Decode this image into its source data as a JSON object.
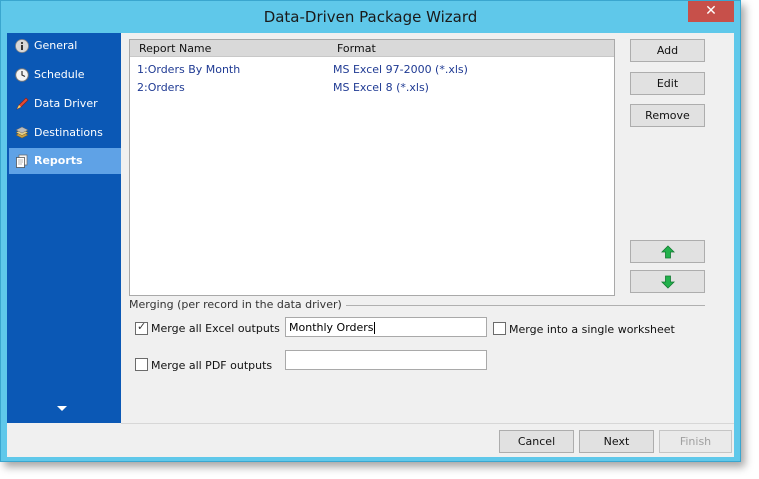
{
  "window": {
    "title": "Data-Driven Package Wizard",
    "close_glyph": "✕"
  },
  "sidebar": {
    "items": [
      {
        "label": "General",
        "icon": "info-icon"
      },
      {
        "label": "Schedule",
        "icon": "clock-icon"
      },
      {
        "label": "Data Driver",
        "icon": "pen-icon"
      },
      {
        "label": "Destinations",
        "icon": "stack-icon"
      },
      {
        "label": "Reports",
        "icon": "documents-icon",
        "active": true
      }
    ]
  },
  "reports": {
    "columns": [
      "Report Name",
      "Format"
    ],
    "rows": [
      {
        "name": "1:Orders By Month",
        "format": "MS Excel 97-2000 (*.xls)"
      },
      {
        "name": "2:Orders",
        "format": "MS Excel 8 (*.xls)"
      }
    ]
  },
  "actions": {
    "add": "Add",
    "edit": "Edit",
    "remove": "Remove"
  },
  "merging": {
    "legend": "Merging (per record in the data driver)",
    "excel_label": "Merge all Excel outputs",
    "excel_checked": true,
    "excel_value": "Monthly Orders",
    "single_sheet_label": "Merge into a single worksheet",
    "single_sheet_checked": false,
    "pdf_label": "Merge all PDF outputs",
    "pdf_checked": false,
    "pdf_value": ""
  },
  "footer": {
    "cancel": "Cancel",
    "next": "Next",
    "finish": "Finish"
  },
  "colors": {
    "title_bar": "#5fc8ea",
    "sidebar": "#0b58b5",
    "sidebar_active": "#5fa2e6",
    "arrow_green": "#22b14c"
  }
}
